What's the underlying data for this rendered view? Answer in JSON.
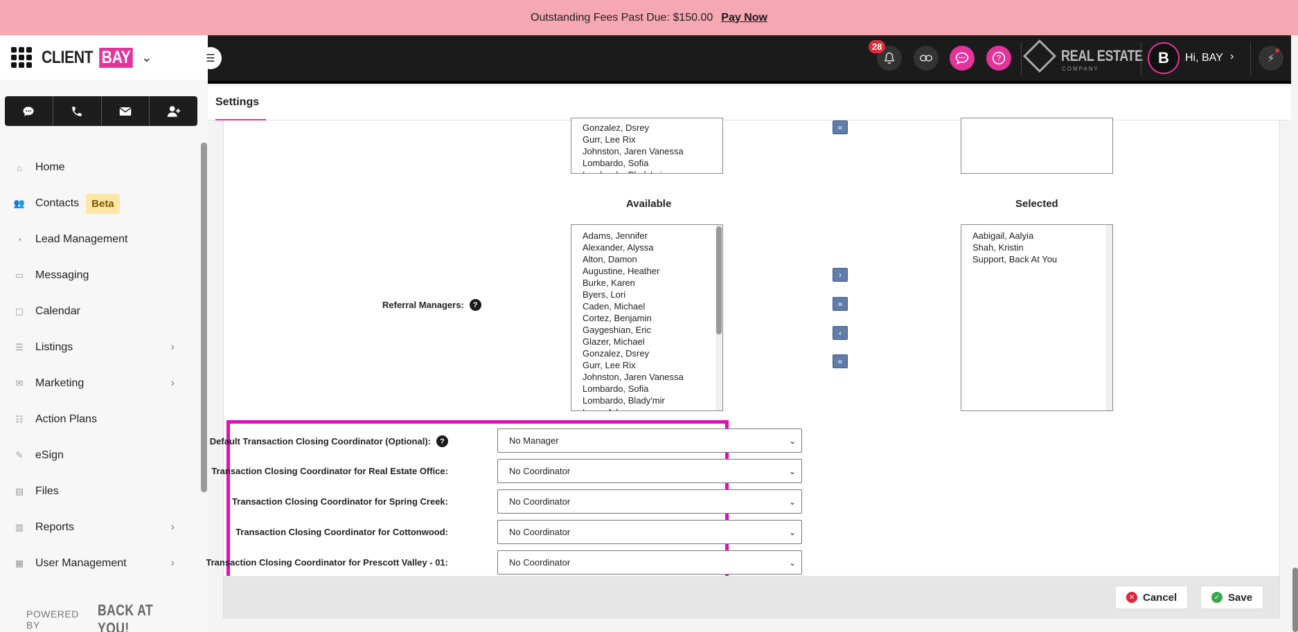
{
  "banner": {
    "text": "Outstanding Fees Past Due: $150.00",
    "link": "Pay Now"
  },
  "brand": {
    "client": "CLIENT",
    "bay": "BAY"
  },
  "sidebar": {
    "items": [
      {
        "label": "Home",
        "icon": "home-icon"
      },
      {
        "label": "Contacts",
        "icon": "contacts-icon",
        "badge": "Beta"
      },
      {
        "label": "Lead Management",
        "icon": "lead-icon"
      },
      {
        "label": "Messaging",
        "icon": "messaging-icon"
      },
      {
        "label": "Calendar",
        "icon": "calendar-icon"
      },
      {
        "label": "Listings",
        "icon": "listings-icon",
        "chevron": true
      },
      {
        "label": "Marketing",
        "icon": "marketing-icon",
        "chevron": true
      },
      {
        "label": "Action Plans",
        "icon": "action-plans-icon"
      },
      {
        "label": "eSign",
        "icon": "esign-icon"
      },
      {
        "label": "Files",
        "icon": "files-icon"
      },
      {
        "label": "Reports",
        "icon": "reports-icon",
        "chevron": true
      },
      {
        "label": "User Management",
        "icon": "user-management-icon",
        "chevron": true
      }
    ],
    "powered_by": "POWERED BY",
    "powered_logo": "BACK AT YOU!"
  },
  "header": {
    "notifications_count": "28",
    "company_logo": "REAL ESTATE",
    "company_sub": "COMPANY",
    "avatar_letter": "B",
    "greeting": "Hi, BAY"
  },
  "tabs": {
    "settings": "Settings"
  },
  "top_list": {
    "items": [
      "Gonzalez, Dsrey",
      "Gurr, Lee Rix",
      "Johnston, Jaren Vanessa",
      "Lombardo, Sofia",
      "Lombardo, Blady'mir"
    ]
  },
  "referral": {
    "label": "Referral Managers:",
    "available_title": "Available",
    "selected_title": "Selected",
    "available": [
      "Adams, Jennifer",
      "Alexander, Alyssa",
      "Alton, Damon",
      "Augustine, Heather",
      "Burke, Karen",
      "Byers, Lori",
      "Caden, Michael",
      "Cortez, Benjamin",
      "Gaygeshian, Eric",
      "Glazer, Michael",
      "Gonzalez, Dsrey",
      "Gurr, Lee Rix",
      "Johnston, Jaren Vanessa",
      "Lombardo, Sofia",
      "Lombardo, Blady'mir",
      "Long, Adam"
    ],
    "selected": [
      "Aabigail, Aalyia",
      "Shah, Kristin",
      "Support, Back At You"
    ]
  },
  "coordinators": [
    {
      "label": "Default Transaction Closing Coordinator (Optional):",
      "value": "No Manager",
      "help": true
    },
    {
      "label": "Transaction Closing Coordinator for Real Estate Office:",
      "value": "No Coordinator"
    },
    {
      "label": "Transaction Closing Coordinator for Spring Creek:",
      "value": "No Coordinator"
    },
    {
      "label": "Transaction Closing Coordinator for Cottonwood:",
      "value": "No Coordinator"
    },
    {
      "label": "Transaction Closing Coordinator for Prescott Valley - 01:",
      "value": "No Coordinator"
    }
  ],
  "footer": {
    "cancel": "Cancel",
    "save": "Save"
  },
  "colors": {
    "accent": "#e4339a",
    "highlight": "#e010b8",
    "banner": "#f5a7b2"
  }
}
